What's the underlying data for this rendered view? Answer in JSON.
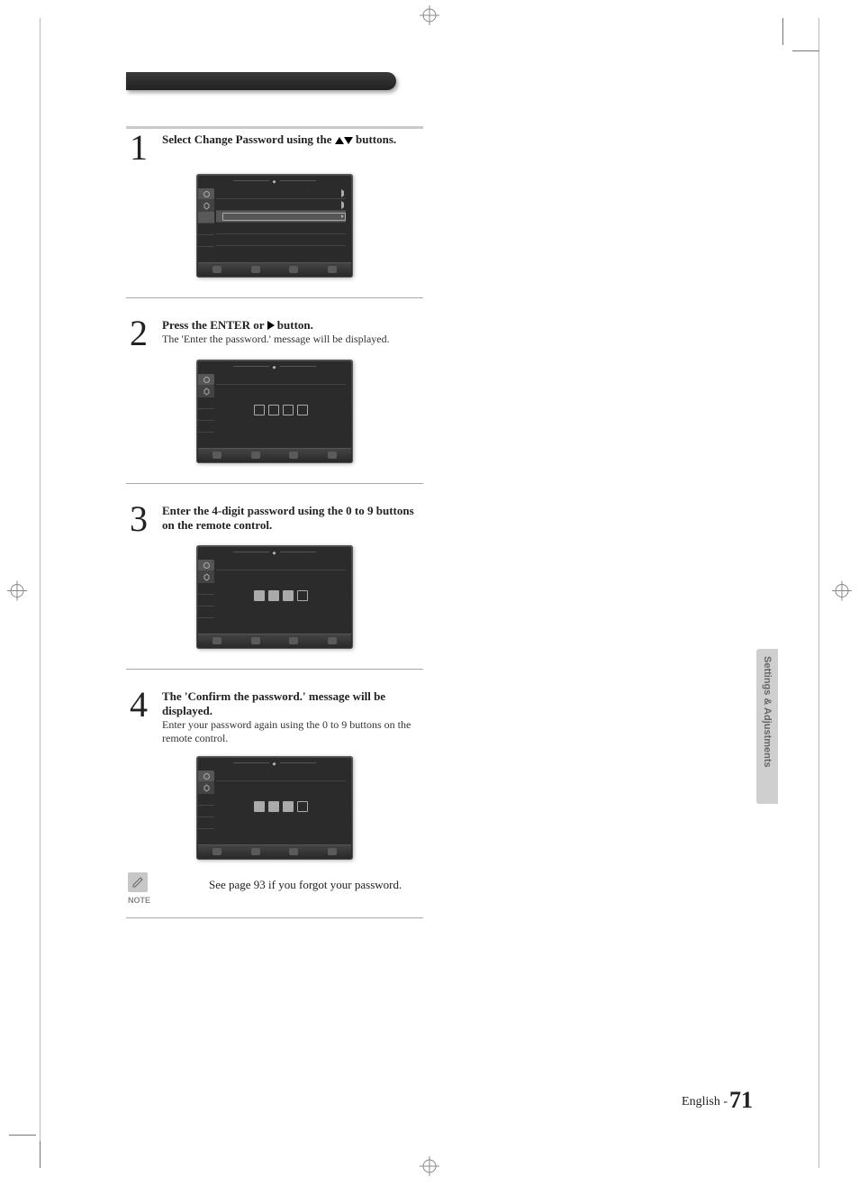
{
  "steps": [
    {
      "num": "1",
      "title_a": "Select Change Password using the ",
      "title_b": " buttons.",
      "sub": "",
      "tv": {
        "mode": "menu",
        "diamond": "◆",
        "row3_hl": true
      }
    },
    {
      "num": "2",
      "title_a": "Press the ENTER or ",
      "title_b": " button.",
      "sub": "The 'Enter the password.' message will be displayed.",
      "tv": {
        "mode": "pin",
        "diamond": "◆",
        "filled": 0
      }
    },
    {
      "num": "3",
      "title_a": "Enter the 4-digit password using the 0 to 9 buttons on the remote control.",
      "title_b": "",
      "sub": "",
      "tv": {
        "mode": "pin",
        "diamond": "◆",
        "filled": 3
      }
    },
    {
      "num": "4",
      "title_a": "The 'Confirm the password.' message will be displayed.",
      "title_b": "",
      "sub": "Enter your password again using the 0 to 9 buttons on the remote control.",
      "tv": {
        "mode": "pin",
        "diamond": "◆",
        "filled": 3
      }
    }
  ],
  "note": {
    "label": "NOTE",
    "text": "See page 93 if you forgot your password."
  },
  "side_tab": "Settings & Adjustments",
  "footer": {
    "lang": "English -",
    "page": "71"
  }
}
